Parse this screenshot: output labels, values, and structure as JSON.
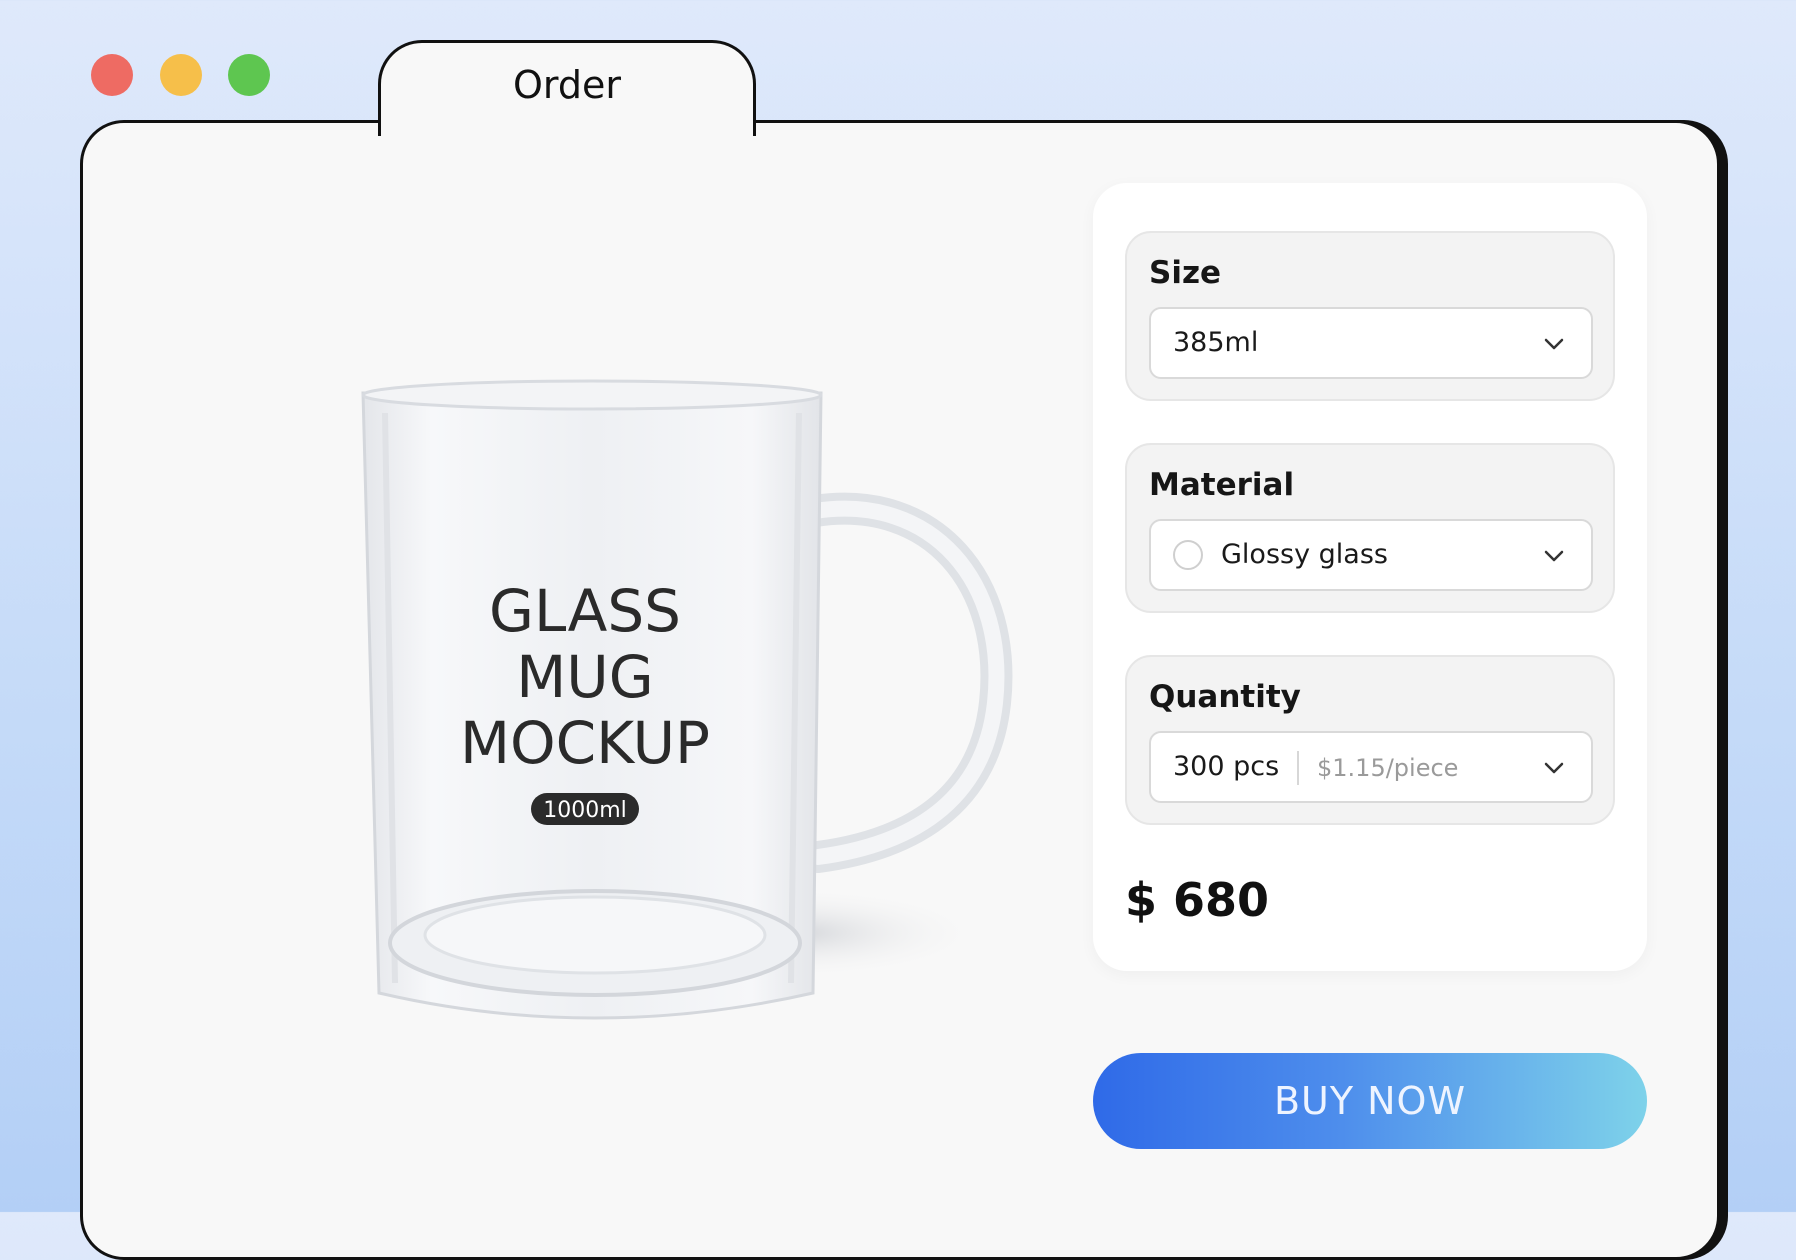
{
  "window": {
    "tab_title": "Order"
  },
  "product_image": {
    "print_lines": [
      "GLASS",
      "MUG",
      "MOCKUP"
    ],
    "volume_badge": "1000ml"
  },
  "order": {
    "size": {
      "label": "Size",
      "value": "385ml"
    },
    "material": {
      "label": "Material",
      "value": "Glossy glass"
    },
    "quantity": {
      "label": "Quantity",
      "value": "300 pcs",
      "unit_price": "$1.15/piece"
    },
    "total": "$ 680"
  },
  "actions": {
    "buy_label": "BUY NOW"
  },
  "colors": {
    "close": "#ee6b63",
    "minimize": "#f6bf4a",
    "maximize": "#5ec650",
    "buy_gradient_start": "#2f6ae8",
    "buy_gradient_end": "#7ed2ea"
  },
  "icons": [
    "close-dot",
    "minimize-dot",
    "maximize-dot",
    "chevron-down-icon",
    "radio-circle-icon"
  ]
}
